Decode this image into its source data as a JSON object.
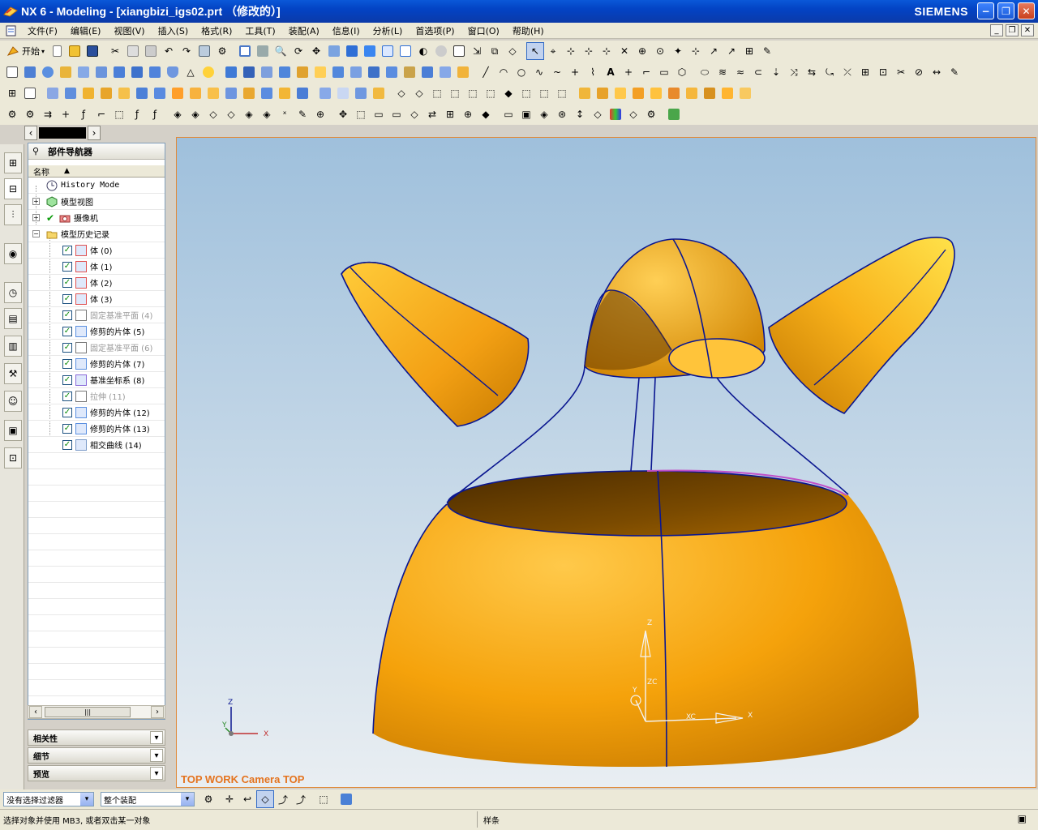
{
  "window": {
    "title": "NX 6 - Modeling - [xiangbizi_igs02.prt （修改的）]",
    "brand": "SIEMENS",
    "minimize": "−",
    "restore": "❐",
    "close": "✕"
  },
  "menu": {
    "items": [
      "文件(F)",
      "编辑(E)",
      "视图(V)",
      "插入(S)",
      "格式(R)",
      "工具(T)",
      "装配(A)",
      "信息(I)",
      "分析(L)",
      "首选项(P)",
      "窗口(O)",
      "帮助(H)"
    ]
  },
  "toolbar": {
    "start_label": "开始"
  },
  "navigator": {
    "title": "部件导航器",
    "column_header": "名称",
    "history_mode": "History Mode",
    "model_views": "模型视图",
    "cameras": "摄像机",
    "model_history": "模型历史记录",
    "features": [
      {
        "label": "体 (0)",
        "checked": true,
        "dim": false
      },
      {
        "label": "体 (1)",
        "checked": true,
        "dim": false
      },
      {
        "label": "体 (2)",
        "checked": true,
        "dim": false
      },
      {
        "label": "体 (3)",
        "checked": true,
        "dim": false
      },
      {
        "label": "固定基准平面 (4)",
        "checked": true,
        "dim": true
      },
      {
        "label": "修剪的片体 (5)",
        "checked": true,
        "dim": false
      },
      {
        "label": "固定基准平面 (6)",
        "checked": true,
        "dim": true
      },
      {
        "label": "修剪的片体 (7)",
        "checked": true,
        "dim": false
      },
      {
        "label": "基准坐标系 (8)",
        "checked": true,
        "dim": false
      },
      {
        "label": "拉伸 (11)",
        "checked": true,
        "dim": true
      },
      {
        "label": "修剪的片体 (12)",
        "checked": true,
        "dim": false
      },
      {
        "label": "修剪的片体 (13)",
        "checked": true,
        "dim": false
      },
      {
        "label": "相交曲线 (14)",
        "checked": true,
        "dim": false
      }
    ],
    "scroll_thumb": "|||"
  },
  "panels": {
    "dependencies": "相关性",
    "details": "细节",
    "preview": "预览"
  },
  "viewport": {
    "label": "TOP WORK Camera TOP",
    "triad": {
      "z": "Z",
      "y": "Y",
      "x": "X"
    },
    "wcs": {
      "z": "Z",
      "zc": "ZC",
      "y": "Y",
      "xc": "XC",
      "x": "X"
    },
    "colors": {
      "background_top": "#9fc0dc",
      "background_bottom": "#e9eef2",
      "body": "#f5a20b",
      "edge": "#0a1690",
      "highlight": "#c050c8"
    }
  },
  "selection_bar": {
    "filter": "没有选择过滤器",
    "scope": "整个装配"
  },
  "status": {
    "prompt": "选择对象并使用 MB3, 或者双击某一对象",
    "message": "样条"
  }
}
